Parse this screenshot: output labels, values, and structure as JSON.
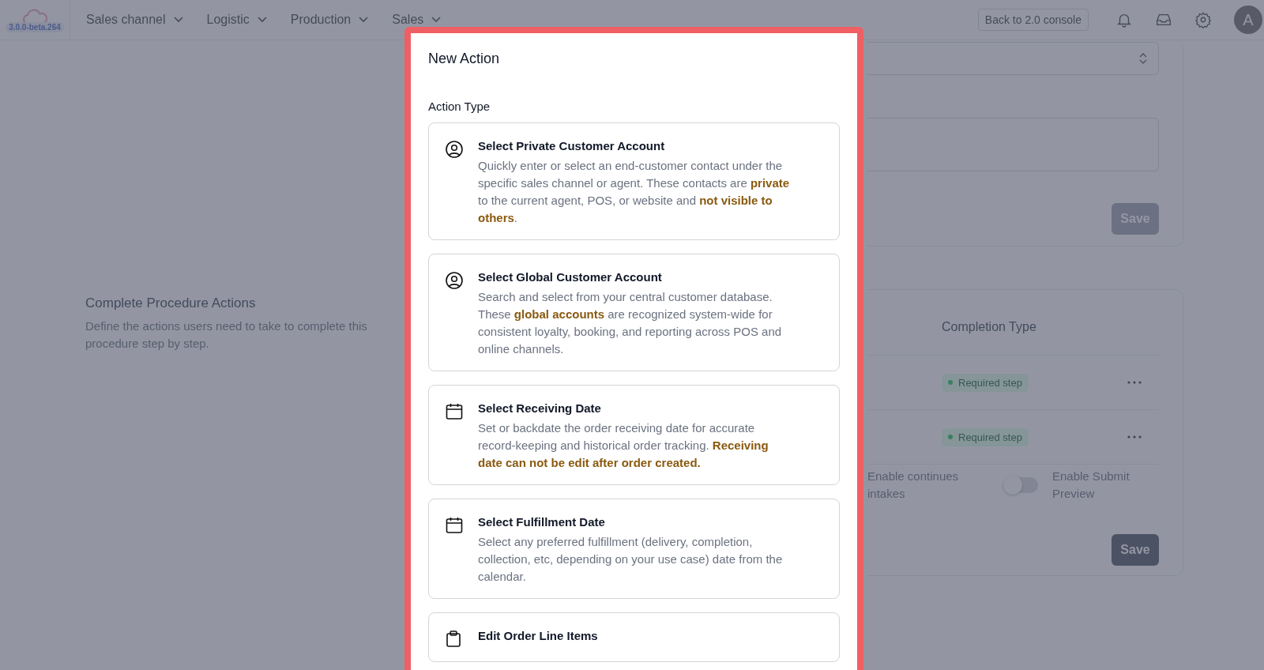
{
  "app": {
    "version": "3.0.0-beta.264"
  },
  "nav": {
    "menus": [
      {
        "label": "Sales channel"
      },
      {
        "label": "Logistic"
      },
      {
        "label": "Production"
      },
      {
        "label": "Sales"
      }
    ],
    "console_button": "Back to 2.0 console",
    "avatar": "A"
  },
  "background": {
    "top_card": {
      "save": {
        "label": "Save",
        "disabled": true
      }
    },
    "section": {
      "title": "Complete Procedure Actions",
      "description": "Define the actions users need to take to complete this procedure step by step."
    },
    "table": {
      "columns": [
        "Completion Type"
      ],
      "rows": [
        {
          "completion_type": "Required step"
        },
        {
          "completion_type": "Required step"
        }
      ]
    },
    "toggles": [
      {
        "label": "Enable continues intakes"
      },
      {
        "label": "Enable Submit Preview",
        "on": false
      }
    ],
    "save": {
      "label": "Save",
      "disabled": false
    }
  },
  "modal": {
    "title": "New Action",
    "field_label": "Action Type",
    "options": [
      {
        "kind": "person",
        "title": "Select Private Customer Account",
        "description": "Quickly enter or select an end-customer contact under the specific sales channel or agent. These contacts are **private** to the current agent, POS, or website and **not visible to others**."
      },
      {
        "kind": "person",
        "title": "Select Global Customer Account",
        "description": "Search and select from your central customer database. These **global accounts** are recognized system-wide for consistent loyalty, booking, and reporting across POS and online channels."
      },
      {
        "kind": "calendar",
        "title": "Select Receiving Date",
        "description": "Set or backdate the order receiving date for accurate record-keeping and historical order tracking. **Receiving date can not be edit after order created.**"
      },
      {
        "kind": "calendar",
        "title": "Select Fulfillment Date",
        "description": "Select any preferred fulfillment (delivery, completion, collection, etc, depending on your use case) date from the calendar."
      },
      {
        "kind": "clipboard",
        "title": "Edit Order Line Items"
      }
    ]
  }
}
